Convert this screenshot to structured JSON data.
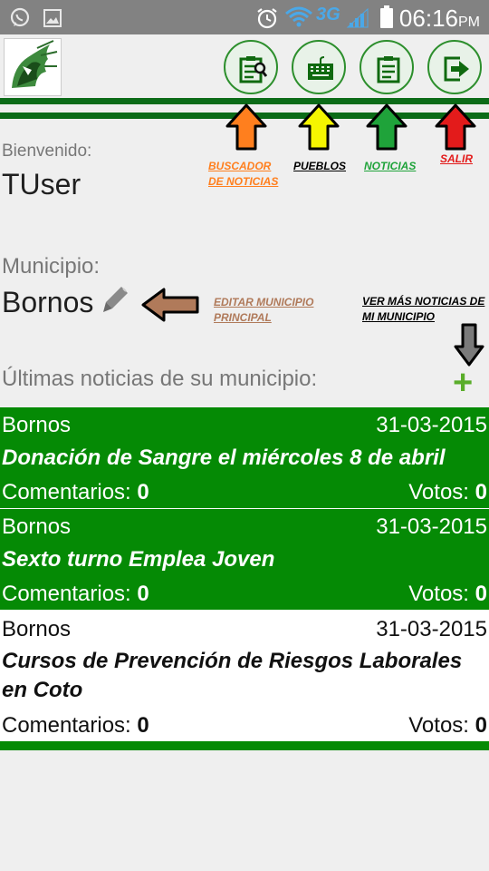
{
  "status_bar": {
    "time": "06:16",
    "ampm": "PM",
    "network": "3G",
    "icons": [
      "whatsapp-icon",
      "image-icon",
      "alarm-icon",
      "wifi-icon",
      "signal-icon",
      "battery-icon"
    ]
  },
  "header": {
    "logo": "app-logo-icon",
    "buttons": [
      {
        "name": "search-news",
        "icon": "clipboard-search-icon"
      },
      {
        "name": "towns",
        "icon": "keyboard-icon"
      },
      {
        "name": "news",
        "icon": "clipboard-icon"
      },
      {
        "name": "logout",
        "icon": "exit-icon"
      }
    ]
  },
  "annotations": {
    "buscador": {
      "line1": "BUSCADOR",
      "line2": "DE NOTICIAS",
      "color": "#ff7f1e"
    },
    "pueblos": {
      "label": "PUEBLOS",
      "color": "#e8e800"
    },
    "noticias": {
      "label": "NOTICIAS",
      "color": "#1fa33a"
    },
    "salir": {
      "label": "SALIR",
      "color": "#e31b1b"
    },
    "editar": {
      "line1": "EDITAR MUNICIPIO",
      "line2": "PRINCIPAL",
      "color": "#b07a5a"
    },
    "ver_mas": {
      "line1": "VER MÁS NOTICIAS DE",
      "line2": "MI MUNICIPIO",
      "color": "#7a7a7a"
    }
  },
  "welcome": {
    "label": "Bienvenido:",
    "user": "TUser"
  },
  "municipality": {
    "label": "Municipio:",
    "name": "Bornos"
  },
  "latest": {
    "heading": "Últimas noticias de su municipio:",
    "add_symbol": "+"
  },
  "news": [
    {
      "municipality": "Bornos",
      "date": "31-03-2015",
      "title": "Donación de Sangre el miércoles 8 de abril",
      "comments_label": "Comentarios:",
      "comments": "0",
      "votes_label": "Votos:",
      "votes": "0",
      "highlight": true
    },
    {
      "municipality": "Bornos",
      "date": "31-03-2015",
      "title": "Sexto turno Emplea Joven",
      "comments_label": "Comentarios:",
      "comments": "0",
      "votes_label": "Votos:",
      "votes": "0",
      "highlight": true
    },
    {
      "municipality": "Bornos",
      "date": "31-03-2015",
      "title": "Cursos de Prevención de Riesgos Laborales en Coto",
      "comments_label": "Comentarios:",
      "comments": "0",
      "votes_label": "Votos:",
      "votes": "0",
      "highlight": false
    }
  ],
  "colors": {
    "green": "#058a05",
    "dark_green": "#0c6b18",
    "status_bar": "#828282"
  }
}
